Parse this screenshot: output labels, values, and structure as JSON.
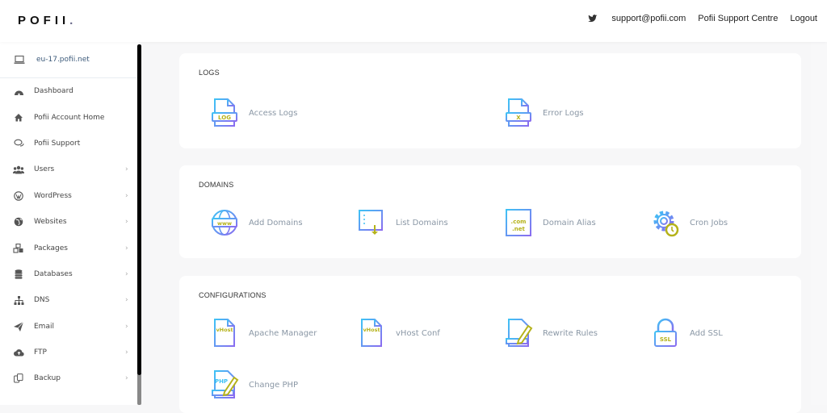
{
  "header": {
    "logo": "POFII",
    "logo_dot": ".",
    "links": [
      "support@pofii.com",
      "Pofii Support Centre",
      "Logout"
    ],
    "twitter_icon": "twitter-icon"
  },
  "sidebar": {
    "server": "eu-17.pofii.net",
    "items": [
      {
        "label": "Dashboard",
        "icon": "dashboard-icon",
        "has_submenu": false
      },
      {
        "label": "Pofii Account Home",
        "icon": "home-icon",
        "has_submenu": false
      },
      {
        "label": "Pofii Support",
        "icon": "chat-icon",
        "has_submenu": false
      },
      {
        "label": "Users",
        "icon": "users-icon",
        "has_submenu": true
      },
      {
        "label": "WordPress",
        "icon": "wordpress-icon",
        "has_submenu": true
      },
      {
        "label": "Websites",
        "icon": "globe-icon",
        "has_submenu": true
      },
      {
        "label": "Packages",
        "icon": "packages-icon",
        "has_submenu": true
      },
      {
        "label": "Databases",
        "icon": "database-icon",
        "has_submenu": true
      },
      {
        "label": "DNS",
        "icon": "sitemap-icon",
        "has_submenu": true
      },
      {
        "label": "Email",
        "icon": "paper-plane-icon",
        "has_submenu": true
      },
      {
        "label": "FTP",
        "icon": "cloud-upload-icon",
        "has_submenu": true
      },
      {
        "label": "Backup",
        "icon": "copy-icon",
        "has_submenu": true
      }
    ],
    "chevron": "›"
  },
  "sections": [
    {
      "title": "LOGS",
      "tiles": [
        {
          "label": "Access Logs",
          "badge": "LOG"
        },
        {
          "label": "Error Logs",
          "badge": "X"
        }
      ]
    },
    {
      "title": "DOMAINS",
      "tiles": [
        {
          "label": "Add Domains",
          "badge": "www"
        },
        {
          "label": "List Domains"
        },
        {
          "label": "Domain Alias",
          "badge": ".com",
          "badge2": ".net"
        },
        {
          "label": "Cron Jobs"
        }
      ]
    },
    {
      "title": "CONFIGURATIONS",
      "tiles": [
        {
          "label": "Apache Manager",
          "badge": "vHost"
        },
        {
          "label": "vHost Conf",
          "badge": "vHost"
        },
        {
          "label": "Rewrite Rules"
        },
        {
          "label": "Add SSL",
          "badge": "SSL"
        },
        {
          "label": "Change PHP",
          "badge": "PHP"
        }
      ]
    }
  ],
  "colors": {
    "icon_blue": "#3fc2f5",
    "icon_purple": "#8a6cf0",
    "icon_accent": "#b5b21a"
  }
}
